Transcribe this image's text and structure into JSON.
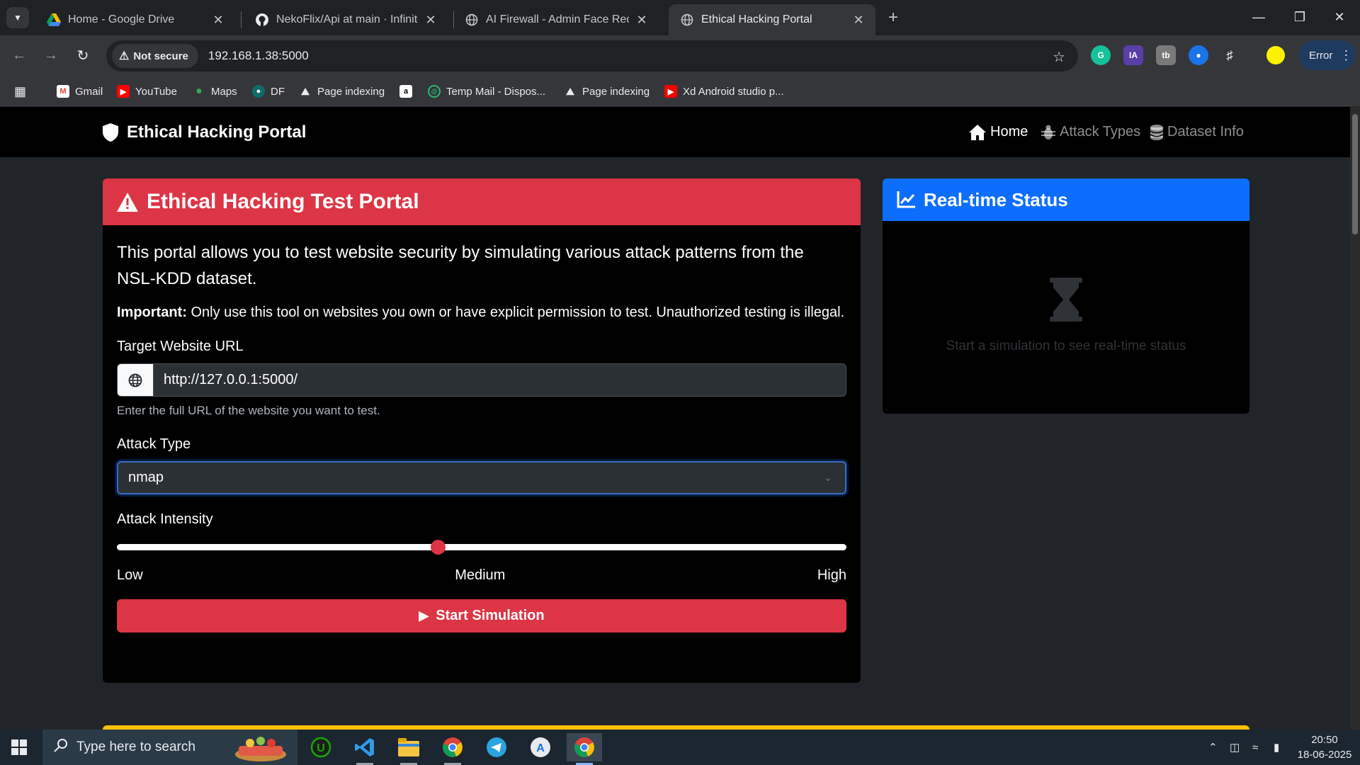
{
  "browser": {
    "tabs": [
      {
        "title": "Home - Google Drive",
        "icon": "google-drive-icon",
        "active": false
      },
      {
        "title": "NekoFlix/Api at main · Infinite-N",
        "icon": "github-icon",
        "active": false
      },
      {
        "title": "AI Firewall - Admin Face Recogn",
        "icon": "globe-icon",
        "active": false
      },
      {
        "title": "Ethical Hacking Portal",
        "icon": "globe-icon",
        "active": true
      }
    ],
    "security_label": "Not secure",
    "url": "192.168.1.38:5000",
    "profile_button_label": "Error",
    "extensions": [
      "grammarly-icon",
      "ia-icon",
      "extension-tb-icon",
      "extension-blue-icon",
      "puzzle-icon"
    ]
  },
  "bookmarks": [
    {
      "label": "Gmail",
      "icon": "gmail-icon"
    },
    {
      "label": "YouTube",
      "icon": "youtube-icon"
    },
    {
      "label": "Maps",
      "icon": "maps-icon"
    },
    {
      "label": "DF",
      "icon": "df-icon"
    },
    {
      "label": "Page indexing",
      "icon": "page-indexing-icon"
    },
    {
      "label": "",
      "icon": "amazon-icon"
    },
    {
      "label": "Temp Mail - Dispos...",
      "icon": "temp-mail-icon"
    },
    {
      "label": "Page indexing",
      "icon": "page-indexing-icon"
    },
    {
      "label": "Xd Android studio p...",
      "icon": "youtube-icon"
    }
  ],
  "site": {
    "brand": "Ethical Hacking Portal",
    "nav": [
      {
        "label": "Home",
        "icon": "home-icon",
        "active": true
      },
      {
        "label": "Attack Types",
        "icon": "bug-icon",
        "active": false
      },
      {
        "label": "Dataset Info",
        "icon": "database-icon",
        "active": false
      }
    ]
  },
  "main_card": {
    "title": "Ethical Hacking Test Portal",
    "lead": "This portal allows you to test website security by simulating various attack patterns from the NSL-KDD dataset.",
    "note_strong": "Important:",
    "note_text": " Only use this tool on websites you own or have explicit permission to test. Unauthorized testing is illegal.",
    "url_label": "Target Website URL",
    "url_value": "http://127.0.0.1:5000/",
    "url_help": "Enter the full URL of the website you want to test.",
    "attack_type_label": "Attack Type",
    "attack_type_value": "nmap",
    "intensity_label": "Attack Intensity",
    "intensity_value": 0.44,
    "intensity_low": "Low",
    "intensity_medium": "Medium",
    "intensity_high": "High",
    "start_button": "Start Simulation"
  },
  "status_card": {
    "title": "Real-time Status",
    "placeholder": "Start a simulation to see real-time status"
  },
  "taskbar": {
    "search_placeholder": "Type here to search",
    "apps": [
      "widgets-icon",
      "upwork-icon",
      "vscode-icon",
      "file-explorer-icon",
      "chrome-profile-icon",
      "telegram-icon",
      "app-store-icon",
      "chrome-icon"
    ],
    "time": "20:50",
    "date": "18-06-2025"
  },
  "colors": {
    "danger": "#dc3545",
    "primary": "#0d6efd",
    "warning": "#ffc107"
  }
}
